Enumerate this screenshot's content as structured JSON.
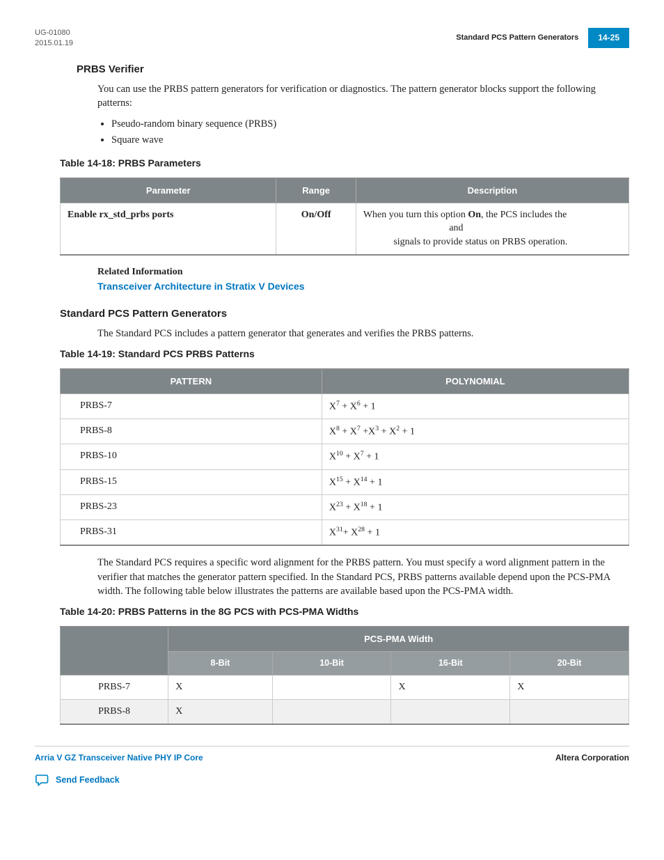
{
  "header": {
    "doc_id": "UG-01080",
    "date": "2015.01.19",
    "title": "Standard PCS Pattern Generators",
    "page_num": "14-25"
  },
  "prbs_verifier": {
    "heading": "PRBS Verifier",
    "intro": "You can use the PRBS pattern generators for verification or diagnostics. The pattern generator blocks support the following patterns:",
    "bullets": [
      "Pseudo-random binary sequence (PRBS)",
      "Square wave"
    ]
  },
  "table18": {
    "title": "Table 14-18: PRBS Parameters",
    "headers": [
      "Parameter",
      "Range",
      "Description"
    ],
    "rows": [
      {
        "param": "Enable rx_std_prbs ports",
        "range": "On/Off",
        "desc_pre": "When you turn this option ",
        "desc_on": "On",
        "desc_mid": ", the PCS includes the ",
        "desc_and": " and ",
        "desc_post": " signals to provide status on PRBS operation."
      }
    ]
  },
  "related": {
    "label": "Related Information",
    "link": "Transceiver Architecture in Stratix V Devices"
  },
  "std_pcs": {
    "heading": "Standard PCS Pattern Generators",
    "intro": "The Standard PCS includes a pattern generator that generates and verifies the PRBS patterns."
  },
  "table19": {
    "title": "Table 14-19: Standard PCS PRBS Patterns",
    "headers": [
      "PATTERN",
      "POLYNOMIAL"
    ],
    "rows": [
      {
        "pattern": "PRBS-7",
        "poly_terms": [
          "X",
          "7",
          " + X",
          "6",
          " + 1"
        ]
      },
      {
        "pattern": "PRBS-8",
        "poly_terms": [
          "X",
          "8",
          " + X",
          "7",
          " +X",
          "3",
          " + X",
          "2",
          " + 1"
        ]
      },
      {
        "pattern": "PRBS-10",
        "poly_terms": [
          "X",
          "10",
          " + X",
          "7",
          " + 1"
        ]
      },
      {
        "pattern": "PRBS-15",
        "poly_terms": [
          "X",
          "15",
          " + X",
          "14",
          " + 1"
        ]
      },
      {
        "pattern": "PRBS-23",
        "poly_terms": [
          "X",
          "23",
          " + X",
          "18",
          " + 1"
        ]
      },
      {
        "pattern": "PRBS-31",
        "poly_terms": [
          "X",
          "31",
          "+ X",
          "28",
          " + 1"
        ]
      }
    ]
  },
  "alignment_note": "The Standard PCS requires a specific word alignment for the PRBS pattern. You must specify a word alignment pattern in the verifier that matches the generator pattern specified. In the Standard PCS, PRBS patterns available depend upon the PCS-PMA width. The following table below illustrates the patterns are available based upon the PCS-PMA width.",
  "table20": {
    "title": "Table 14-20: PRBS Patterns in the 8G PCS with PCS-PMA Widths",
    "spanner": "PCS-PMA Width",
    "sub_headers": [
      "8-Bit",
      "10-Bit",
      "16-Bit",
      "20-Bit"
    ],
    "rows": [
      {
        "label": "PRBS-7",
        "cells": [
          "X",
          "",
          "X",
          "X"
        ]
      },
      {
        "label": "PRBS-8",
        "cells": [
          "X",
          "",
          "",
          ""
        ]
      }
    ]
  },
  "footer": {
    "left": "Arria V GZ Transceiver Native PHY IP Core",
    "right": "Altera Corporation",
    "feedback": "Send Feedback"
  }
}
